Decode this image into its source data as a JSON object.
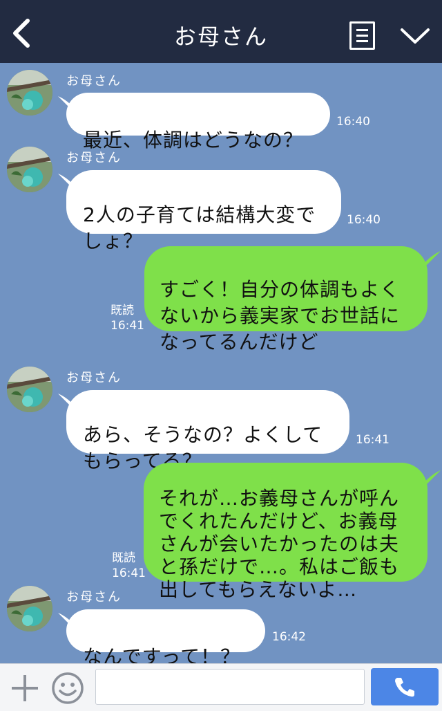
{
  "header": {
    "title": "お母さん",
    "back_icon": "chevron-left-icon",
    "menu_icon": "menu-icon",
    "collapse_icon": "chevron-down-icon"
  },
  "messages": [
    {
      "side": "in",
      "sender": "お母さん",
      "text": "最近、体調はどうなの？",
      "time": "16:40"
    },
    {
      "side": "in",
      "sender": "お母さん",
      "text": "2人の子育ては結構大変で\nしょ？",
      "time": "16:40"
    },
    {
      "side": "out",
      "read": "既読",
      "text": "すごく！自分の体調もよく\nないから義実家でお世話に\nなってるんだけど",
      "time": "16:41"
    },
    {
      "side": "in",
      "sender": "お母さん",
      "text": "あら、そうなの？よくして\nもらってる？",
      "time": "16:41"
    },
    {
      "side": "out",
      "read": "既読",
      "text": "それが…お義母さんが呼ん\nでくれたんだけど、お義母\nさんが会いたかったのは夫\nと孫だけで…。私はご飯も\n出してもらえないよ…",
      "time": "16:41"
    },
    {
      "side": "in",
      "sender": "お母さん",
      "text": "なんですって！？",
      "time": "16:42"
    }
  ],
  "footer": {
    "input_value": "",
    "plus_icon": "plus-icon",
    "emoji_icon": "smiley-icon",
    "send_icon": "phone-icon"
  },
  "colors": {
    "header_bg": "#222b41",
    "chat_bg": "#7193c2",
    "outgoing_bubble": "#7fe04a",
    "incoming_bubble": "#ffffff",
    "send_button": "#4c86e6"
  }
}
